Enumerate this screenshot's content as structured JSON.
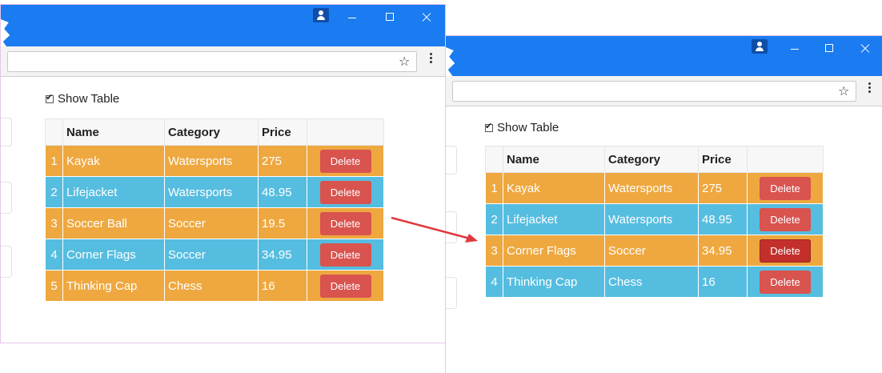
{
  "left_window": {
    "show_table_label": "Show Table",
    "show_table_checked": true,
    "table": {
      "headers": [
        "Name",
        "Category",
        "Price"
      ],
      "rows": [
        {
          "index": "1",
          "name": "Kayak",
          "category": "Watersports",
          "price": "275",
          "action": "Delete"
        },
        {
          "index": "2",
          "name": "Lifejacket",
          "category": "Watersports",
          "price": "48.95",
          "action": "Delete"
        },
        {
          "index": "3",
          "name": "Soccer Ball",
          "category": "Soccer",
          "price": "19.5",
          "action": "Delete"
        },
        {
          "index": "4",
          "name": "Corner Flags",
          "category": "Soccer",
          "price": "34.95",
          "action": "Delete"
        },
        {
          "index": "5",
          "name": "Thinking Cap",
          "category": "Chess",
          "price": "16",
          "action": "Delete"
        }
      ]
    }
  },
  "right_window": {
    "show_table_label": "Show Table",
    "show_table_checked": true,
    "table": {
      "headers": [
        "Name",
        "Category",
        "Price"
      ],
      "rows": [
        {
          "index": "1",
          "name": "Kayak",
          "category": "Watersports",
          "price": "275",
          "action": "Delete"
        },
        {
          "index": "2",
          "name": "Lifejacket",
          "category": "Watersports",
          "price": "48.95",
          "action": "Delete"
        },
        {
          "index": "3",
          "name": "Corner Flags",
          "category": "Soccer",
          "price": "34.95",
          "action": "Delete"
        },
        {
          "index": "4",
          "name": "Thinking Cap",
          "category": "Chess",
          "price": "16",
          "action": "Delete"
        }
      ]
    }
  },
  "colors": {
    "titlebar": "#1a7cf0",
    "row_odd": "#eea83f",
    "row_even": "#55bde0",
    "delete_button": "#d9534f",
    "delete_button_active": "#c3302c",
    "arrow": "#e0393d"
  },
  "icons": [
    "user-icon",
    "minimize-icon",
    "maximize-icon",
    "close-icon",
    "star-icon",
    "menu-icon",
    "checkbox-icon"
  ]
}
